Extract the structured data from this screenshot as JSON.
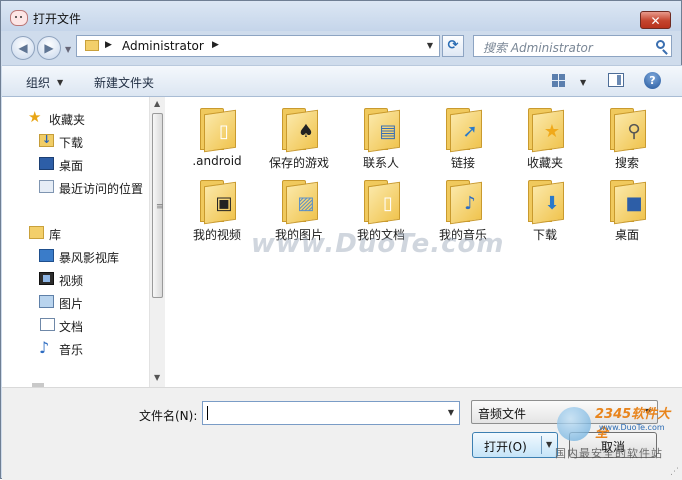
{
  "window": {
    "title": "打开文件",
    "close_glyph": "✕"
  },
  "address": {
    "crumb": "Administrator",
    "search_placeholder": "搜索 Administrator"
  },
  "toolbar": {
    "organize": "组织",
    "new_folder": "新建文件夹"
  },
  "nav": {
    "favorites": {
      "label": "收藏夹",
      "icon": "star-icon"
    },
    "favorite_items": [
      {
        "label": "下载",
        "icon": "download-folder-icon"
      },
      {
        "label": "桌面",
        "icon": "desktop-icon"
      },
      {
        "label": "最近访问的位置",
        "icon": "recent-places-icon"
      }
    ],
    "libraries": {
      "label": "库",
      "icon": "library-icon"
    },
    "library_items": [
      {
        "label": "暴风影视库",
        "icon": "storm-library-icon"
      },
      {
        "label": "视频",
        "icon": "video-icon"
      },
      {
        "label": "图片",
        "icon": "pictures-icon"
      },
      {
        "label": "文档",
        "icon": "documents-icon"
      },
      {
        "label": "音乐",
        "icon": "music-icon"
      }
    ]
  },
  "files": [
    {
      "label": ".android",
      "icon": "folder-documents-icon"
    },
    {
      "label": "保存的游戏",
      "icon": "folder-games-icon"
    },
    {
      "label": "联系人",
      "icon": "folder-contacts-icon"
    },
    {
      "label": "链接",
      "icon": "folder-links-icon"
    },
    {
      "label": "收藏夹",
      "icon": "folder-favorites-icon"
    },
    {
      "label": "搜索",
      "icon": "folder-search-icon"
    },
    {
      "label": "我的视频",
      "icon": "folder-videos-icon"
    },
    {
      "label": "我的图片",
      "icon": "folder-pictures-icon"
    },
    {
      "label": "我的文档",
      "icon": "folder-documents-icon"
    },
    {
      "label": "我的音乐",
      "icon": "folder-music-icon"
    },
    {
      "label": "下载",
      "icon": "folder-downloads-icon"
    },
    {
      "label": "桌面",
      "icon": "folder-desktop-icon"
    }
  ],
  "watermark": "www.DuoTe.com",
  "bottom": {
    "filename_label": "文件名(N):",
    "filename_value": "",
    "filetype": "音频文件",
    "open": "打开(O)",
    "cancel": "取消"
  },
  "brand": {
    "logo": "2345软件大全",
    "url": "www.DuoTe.com",
    "slogan": "国内最安全的软件站"
  },
  "colors": {
    "accent": "#3c7fb1",
    "folder": "#f0c95d",
    "close": "#c4442d"
  }
}
